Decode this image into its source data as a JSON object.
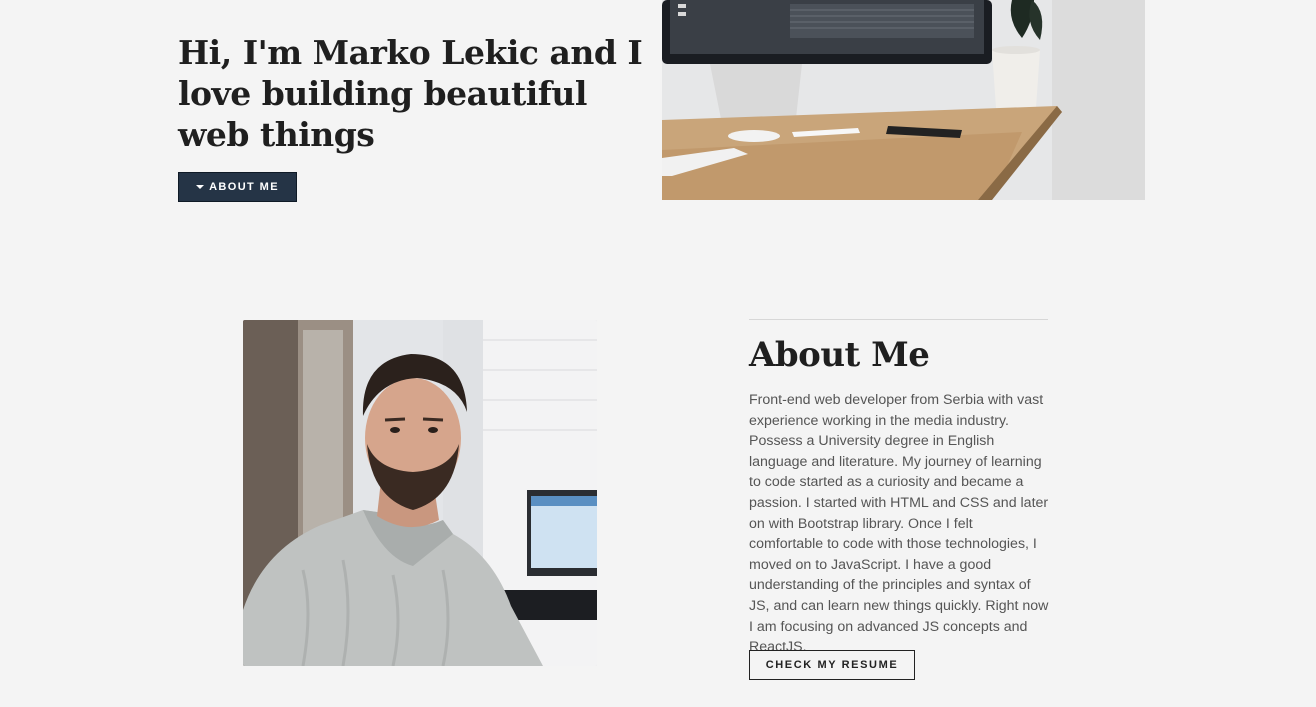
{
  "hero": {
    "heading": "Hi, I'm Marko Lekic and I love building beautiful web things",
    "button_label": "ABOUT ME",
    "button_icon": "caret-down-icon",
    "button_color": "#253446"
  },
  "about": {
    "title": "About Me",
    "text": "Front-end web developer from Serbia with vast experience working in the media industry. Possess a University degree in English language and literature. My journey of learning to code started as a curiosity and became a passion. I started with HTML and CSS and later on with Bootstrap library. Once I felt comfortable to code with those technologies, I moved on to JavaScript. I have a good understanding of the principles and syntax of JS, and can learn new things quickly. Right now I am focusing on advanced JS concepts and ReactJS.",
    "resume_button_label": "CHECK MY RESUME"
  },
  "colors": {
    "background": "#f4f4f4",
    "heading": "#1f1f1f",
    "body_text": "#555555"
  }
}
